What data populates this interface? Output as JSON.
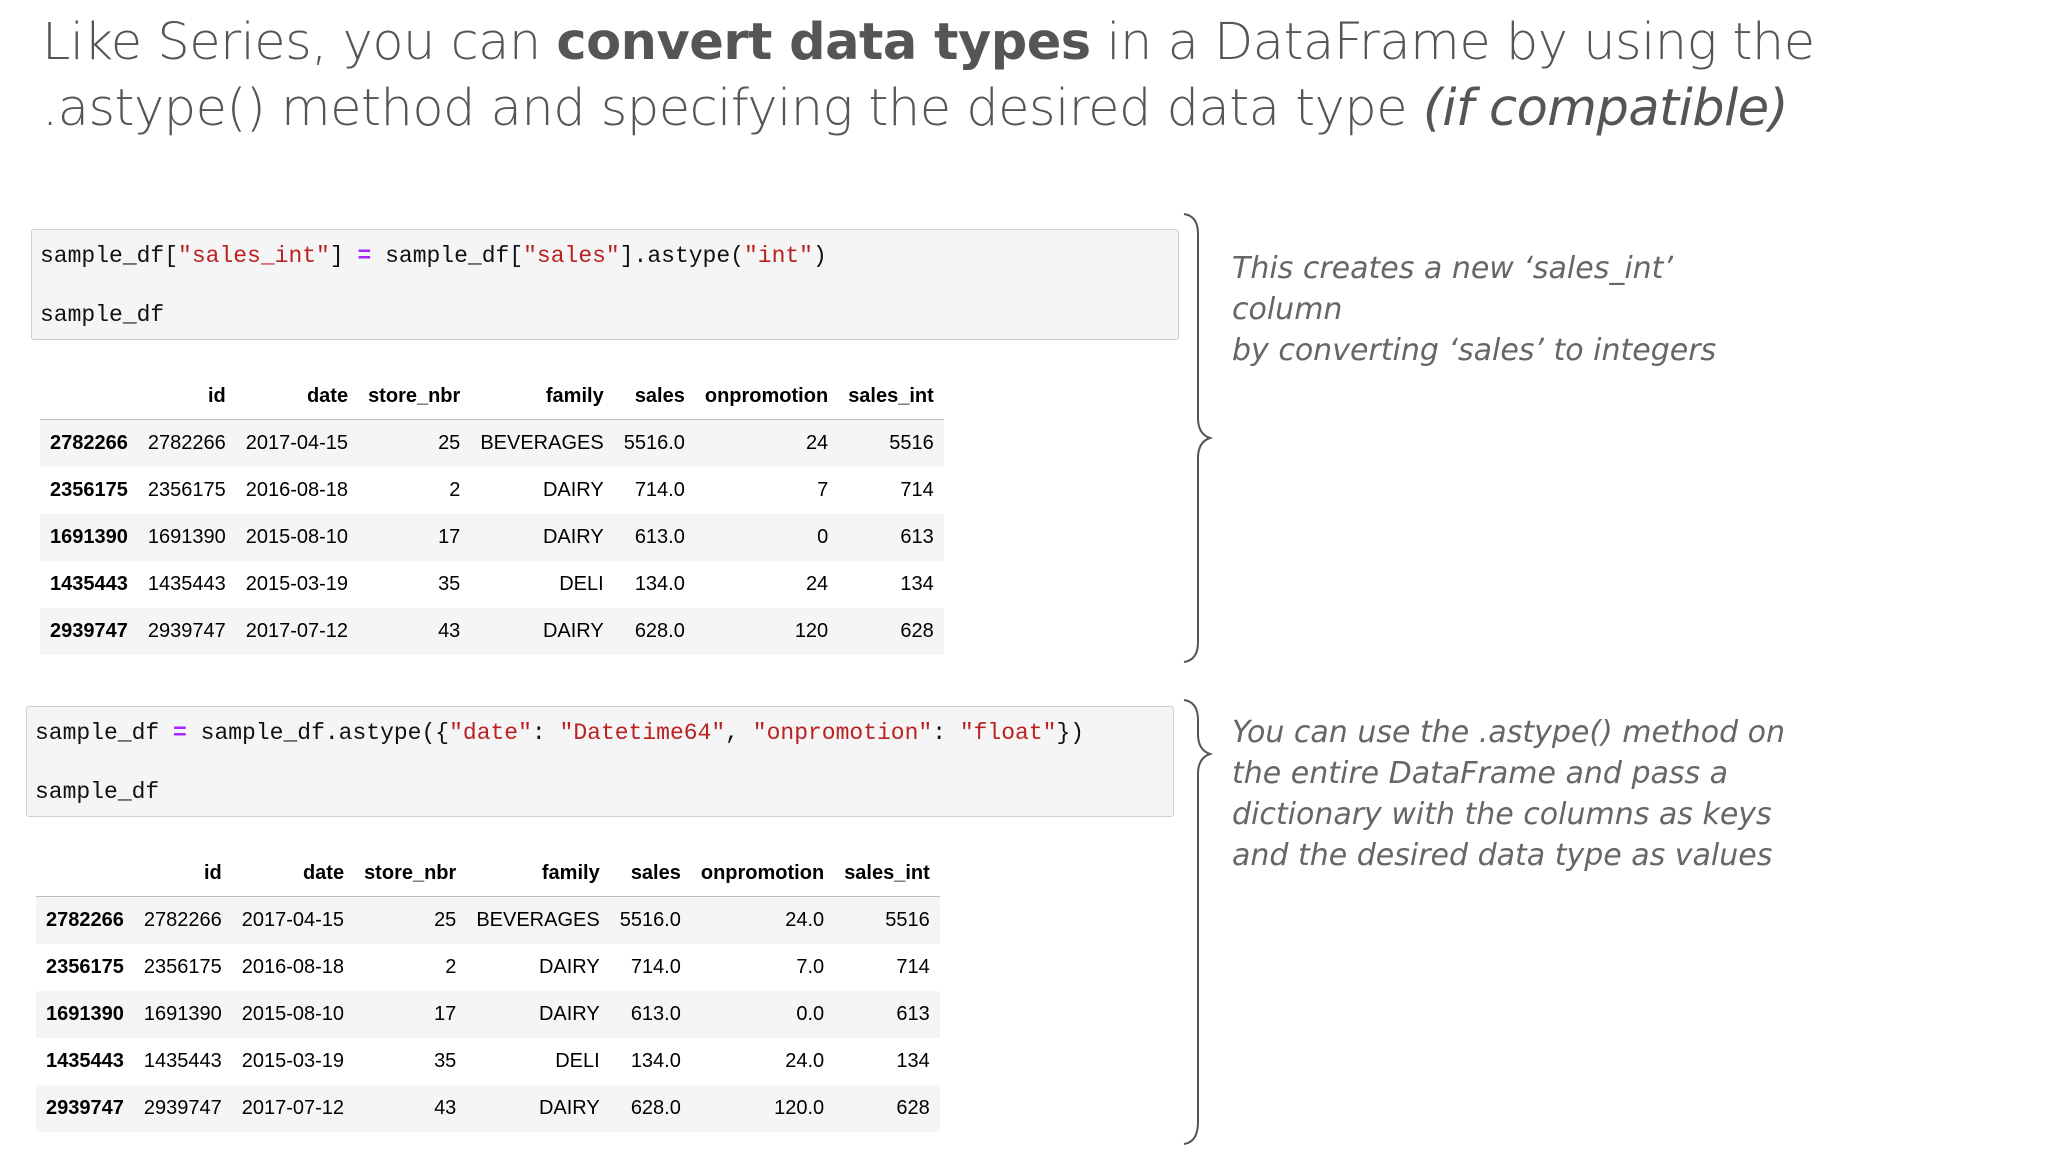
{
  "title": {
    "part1": "Like Series, you can ",
    "bold": "convert data types",
    "part2": " in a DataFrame by using the .astype() method and specifying the desired data type ",
    "italic": "(if compatible)"
  },
  "cell1": {
    "line1": {
      "a": "sample_df[",
      "s1": "\"sales_int\"",
      "b": "] ",
      "op": "=",
      "c": " sample_df[",
      "s2": "\"sales\"",
      "d": "].astype(",
      "s3": "\"int\"",
      "e": ")"
    },
    "line2": "sample_df"
  },
  "cell2": {
    "line1": {
      "a": "sample_df ",
      "op": "=",
      "b": " sample_df.astype({",
      "s1": "\"date\"",
      "c": ": ",
      "s2": "\"Datetime64\"",
      "d": ", ",
      "s3": "\"onpromotion\"",
      "e": ": ",
      "s4": "\"float\"",
      "f": "})"
    },
    "line2": "sample_df"
  },
  "table1": {
    "columns": [
      "",
      "id",
      "date",
      "store_nbr",
      "family",
      "sales",
      "onpromotion",
      "sales_int"
    ],
    "rows": [
      [
        "2782266",
        "2782266",
        "2017-04-15",
        "25",
        "BEVERAGES",
        "5516.0",
        "24",
        "5516"
      ],
      [
        "2356175",
        "2356175",
        "2016-08-18",
        "2",
        "DAIRY",
        "714.0",
        "7",
        "714"
      ],
      [
        "1691390",
        "1691390",
        "2015-08-10",
        "17",
        "DAIRY",
        "613.0",
        "0",
        "613"
      ],
      [
        "1435443",
        "1435443",
        "2015-03-19",
        "35",
        "DELI",
        "134.0",
        "24",
        "134"
      ],
      [
        "2939747",
        "2939747",
        "2017-07-12",
        "43",
        "DAIRY",
        "628.0",
        "120",
        "628"
      ]
    ]
  },
  "table2": {
    "columns": [
      "",
      "id",
      "date",
      "store_nbr",
      "family",
      "sales",
      "onpromotion",
      "sales_int"
    ],
    "rows": [
      [
        "2782266",
        "2782266",
        "2017-04-15",
        "25",
        "BEVERAGES",
        "5516.0",
        "24.0",
        "5516"
      ],
      [
        "2356175",
        "2356175",
        "2016-08-18",
        "2",
        "DAIRY",
        "714.0",
        "7.0",
        "714"
      ],
      [
        "1691390",
        "1691390",
        "2015-08-10",
        "17",
        "DAIRY",
        "613.0",
        "0.0",
        "613"
      ],
      [
        "1435443",
        "1435443",
        "2015-03-19",
        "35",
        "DELI",
        "134.0",
        "24.0",
        "134"
      ],
      [
        "2939747",
        "2939747",
        "2017-07-12",
        "43",
        "DAIRY",
        "628.0",
        "120.0",
        "628"
      ]
    ]
  },
  "note1": {
    "line1": "This creates a new ‘sales_int’ column",
    "line2": "by converting ‘sales’ to integers"
  },
  "note2": {
    "line1": "You can use the .astype() method on",
    "line2": "the entire DataFrame and pass a",
    "line3": "dictionary with the columns as keys",
    "line4": "and the desired data type as values"
  }
}
